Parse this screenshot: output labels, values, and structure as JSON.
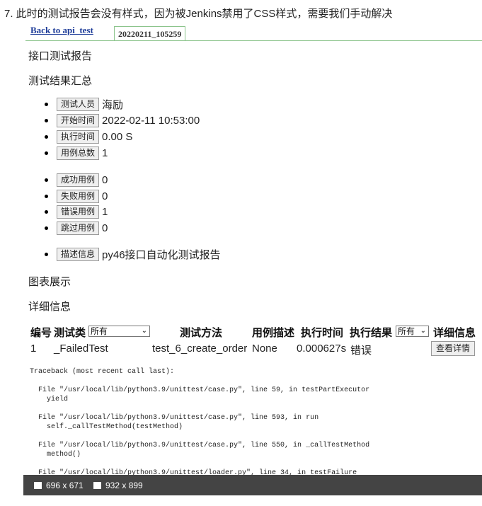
{
  "intro": "7. 此时的测试报告会没有样式，因为被Jenkins禁用了CSS样式，需要我们手动解决",
  "back_link": "Back to api_test",
  "tab": "20220211_105259",
  "report": {
    "title": "接口测试报告",
    "summary_heading": "测试结果汇总",
    "group1": [
      {
        "label": "测试人员",
        "value": "海励"
      },
      {
        "label": "开始时间",
        "value": "2022-02-11 10:53:00"
      },
      {
        "label": "执行时间",
        "value": "0.00 S"
      },
      {
        "label": "用例总数",
        "value": "1"
      }
    ],
    "group2": [
      {
        "label": "成功用例",
        "value": "0"
      },
      {
        "label": "失败用例",
        "value": "0"
      },
      {
        "label": "错误用例",
        "value": "1"
      },
      {
        "label": "跳过用例",
        "value": "0"
      }
    ],
    "group3": [
      {
        "label": "描述信息",
        "value": "py46接口自动化测试报告"
      }
    ],
    "charts_heading": "图表展示",
    "details_heading": "详细信息"
  },
  "table": {
    "headers": {
      "no": "编号",
      "cls": "测试类",
      "cls_filter": "所有",
      "method": "测试方法",
      "desc": "用例描述",
      "time": "执行时间",
      "result": "执行结果",
      "result_filter": "所有",
      "detail": "详细信息"
    },
    "row": {
      "no": "1",
      "cls": "_FailedTest",
      "method": "test_6_create_order",
      "desc": "None",
      "time": "0.000627s",
      "result": "错误",
      "detail_btn": "查看详情"
    }
  },
  "traceback": [
    "Traceback (most recent call last):",
    "  File \"/usr/local/lib/python3.9/unittest/case.py\", line 59, in testPartExecutor",
    "    yield",
    "  File \"/usr/local/lib/python3.9/unittest/case.py\", line 593, in run",
    "    self._callTestMethod(testMethod)",
    "  File \"/usr/local/lib/python3.9/unittest/case.py\", line 550, in _callTestMethod",
    "    method()",
    "  File \"/usr/local/lib/python3.9/unittest/loader.py\", line 34, in testFailure"
  ],
  "statusbar": {
    "viewport": "696 x 671",
    "image": "932 x 899"
  },
  "colors": {
    "link": "#1f3d99",
    "tab_border": "#8bc48b",
    "statusbar": "#444444"
  }
}
